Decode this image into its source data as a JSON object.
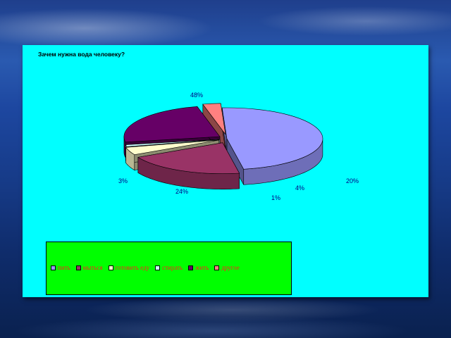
{
  "chart_data": {
    "type": "pie",
    "title": "Зачем нужна вода человеку?",
    "categories": [
      "пить",
      "мыться",
      "готовить еду",
      "стирать",
      "жить",
      "другое"
    ],
    "values": [
      48,
      20,
      4,
      1,
      24,
      3
    ],
    "data_labels": [
      "48%",
      "20%",
      "4%",
      "1%",
      "24%",
      "3%"
    ],
    "colors": [
      "#9999ff",
      "#993366",
      "#ffffcc",
      "#ccffff",
      "#660066",
      "#ff8080"
    ],
    "legend_position": "bottom",
    "style": "3d-exploded"
  }
}
